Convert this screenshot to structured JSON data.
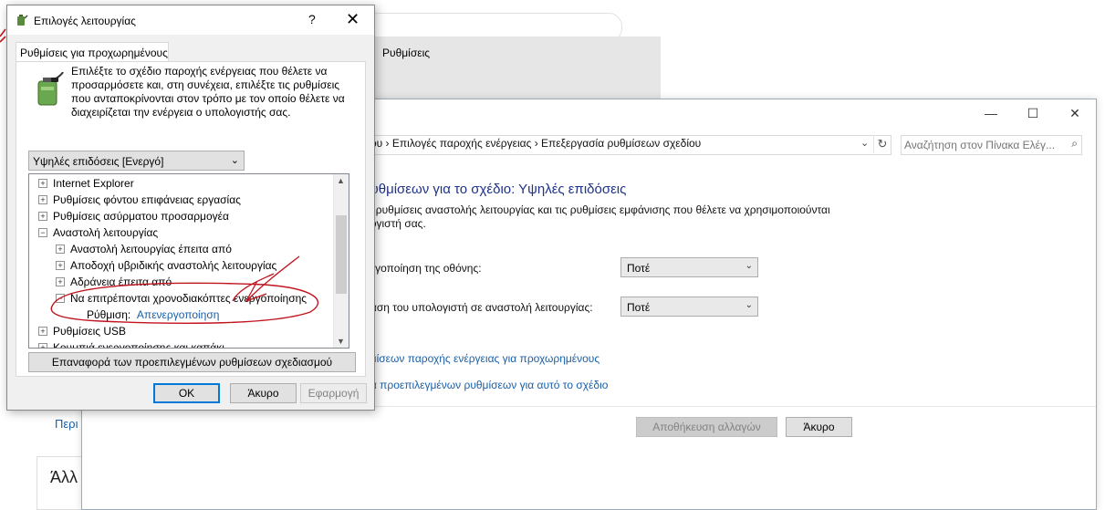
{
  "background": {
    "settings_window_title": "Ρυθμίσεις",
    "left_link": "Περι",
    "left_card": "Άλλ"
  },
  "control_panel": {
    "window_buttons": {
      "minimize": "—",
      "maximize": "☐",
      "close": "✕"
    },
    "breadcrumb": "χου  ›  Επιλογές παροχής ενέργειας  ›  Επεξεργασία ρυθμίσεων σχεδίου",
    "search_placeholder": "Αναζήτηση στον Πίνακα Ελέγ...",
    "plan_title": "ρυθμίσεων για το σχέδιο: Υψηλές επιδόσεις",
    "plan_description_line1": "ις ρυθμίσεις αναστολής λειτουργίας και τις ρυθμίσεις εμφάνισης που θέλετε να χρησιμοποιούνται",
    "plan_description_line2": "λογιστή σας.",
    "display_off_label": "εργοποίηση της οθόνης:",
    "display_off_value": "Ποτέ",
    "sleep_label": "βαση του υπολογιστή σε αναστολή λειτουργίας:",
    "sleep_value": "Ποτέ",
    "advanced_link": "θμίσεων παροχής ενέργειας για προχωρημένους",
    "restore_link": "ρά προεπιλεγμένων ρυθμίσεων για αυτό το σχέδιο",
    "save_button": "Αποθήκευση αλλαγών",
    "cancel_button": "Άκυρο"
  },
  "dialog": {
    "title": "Επιλογές λειτουργίας",
    "help": "?",
    "close": "✕",
    "tab": "Ρυθμίσεις για προχωρημένους",
    "intro": "Επιλέξτε το σχέδιο παροχής ενέργειας που θέλετε να προσαρμόσετε και, στη συνέχεια, επιλέξτε τις ρυθμίσεις που ανταποκρίνονται στον τρόπο με τον οποίο θέλετε να διαχειρίζεται την ενέργεια ο υπολογιστής σας.",
    "plan_select": "Υψηλές επιδόσεις [Ενεργό]",
    "tree": [
      {
        "label": "Internet Explorer",
        "expander": "+"
      },
      {
        "label": "Ρυθμίσεις φόντου επιφάνειας εργασίας",
        "expander": "+"
      },
      {
        "label": "Ρυθμίσεις ασύρματου προσαρμογέα",
        "expander": "+"
      },
      {
        "label": "Αναστολή λειτουργίας",
        "expander": "−"
      },
      {
        "label": "Αναστολή λειτουργίας έπειτα από",
        "expander": "+"
      },
      {
        "label": "Αποδοχή υβριδικής αναστολής λειτουργίας",
        "expander": "+"
      },
      {
        "label": "Αδράνεια έπειτα από",
        "expander": "+"
      },
      {
        "label": "Να επιτρέπονται χρονοδιακόπτες ενεργοποίησης",
        "expander": "−"
      },
      {
        "label": "Ρύθμιση:",
        "value": "Απενεργοποίηση"
      },
      {
        "label": "Ρυθμίσεις USB",
        "expander": "+"
      },
      {
        "label": "Κουμπιά ενεργοποίησης και καπάκι",
        "expander": "+"
      }
    ],
    "restore_defaults": "Επαναφορά των προεπιλεγμένων ρυθμίσεων σχεδιασμού",
    "ok": "OK",
    "cancel": "Άκυρο",
    "apply": "Εφαρμογή"
  },
  "colors": {
    "link": "#1a5fa8",
    "plan_title": "#1e3287",
    "annotation": "#c0141e"
  }
}
